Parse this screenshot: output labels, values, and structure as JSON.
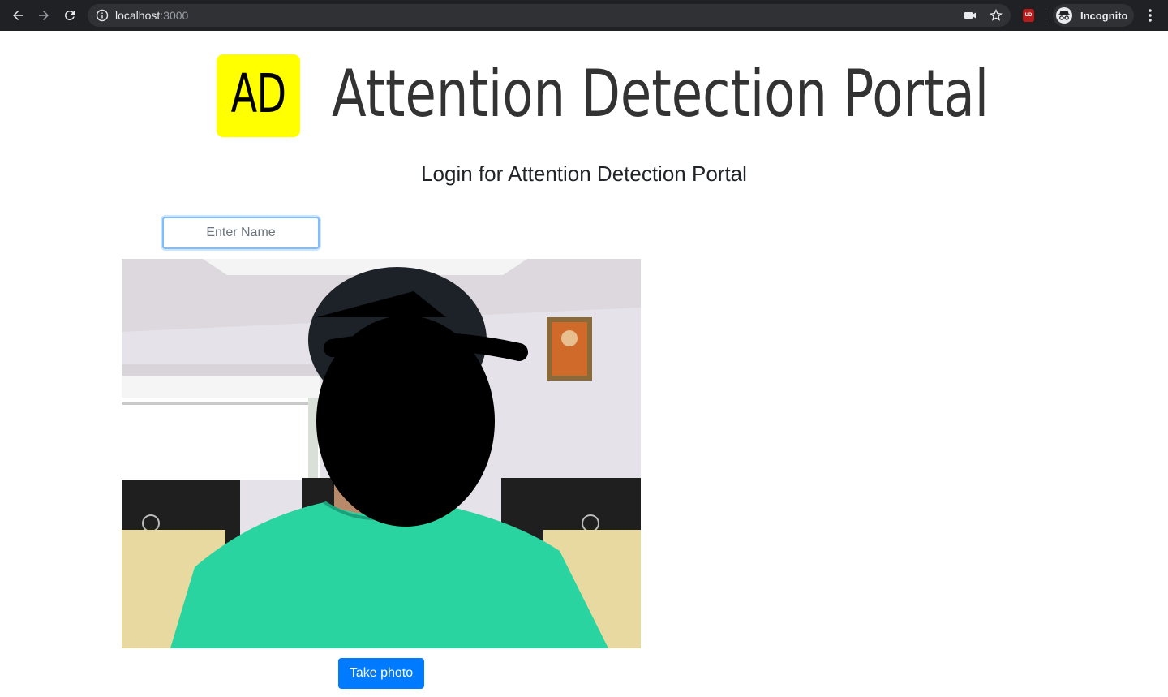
{
  "browser": {
    "url_host": "localhost",
    "url_port": ":3000",
    "profile_label": "Incognito",
    "extension_badge": "UD"
  },
  "header": {
    "logo_text": "AD",
    "title": "Attention Detection Portal",
    "logo_color": "#ffff00"
  },
  "login": {
    "heading": "Login for Attention Detection Portal",
    "name_placeholder": "Enter Name",
    "take_photo_label": "Take photo"
  },
  "colors": {
    "primary_button": "#007bff",
    "input_focus_border": "#80bdff"
  }
}
